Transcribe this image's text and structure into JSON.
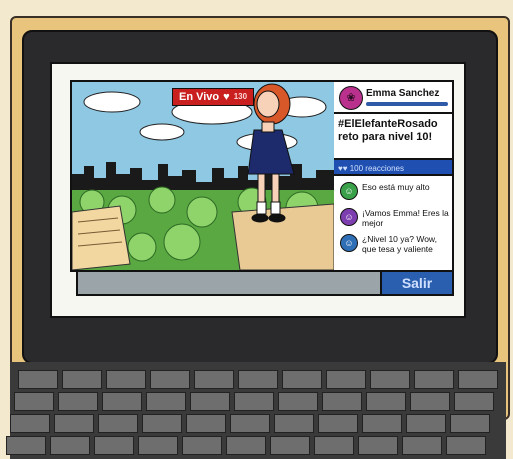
{
  "stream": {
    "live_label": "En Vivo",
    "viewer_count": "130"
  },
  "profile": {
    "name": "Emma Sanchez"
  },
  "post": {
    "text": "#ElElefanteRosado reto para nivel 10!"
  },
  "reactions": {
    "label": "100 reacciones"
  },
  "comments": [
    {
      "text": "Eso está muy alto",
      "icon": "user-icon",
      "color": "#3aa04a"
    },
    {
      "text": "¡Vamos Emma! Eres la mejor",
      "icon": "user-icon",
      "color": "#7d3fb0"
    },
    {
      "text": "¿Nivel 10 ya? Wow, que tesa y valiente",
      "icon": "user-icon",
      "color": "#2f6fb5"
    }
  ],
  "footer": {
    "exit_label": "Salir"
  },
  "colors": {
    "live_red": "#c9201f",
    "accent_blue": "#2a5fb0",
    "avatar_magenta": "#b9318c"
  }
}
